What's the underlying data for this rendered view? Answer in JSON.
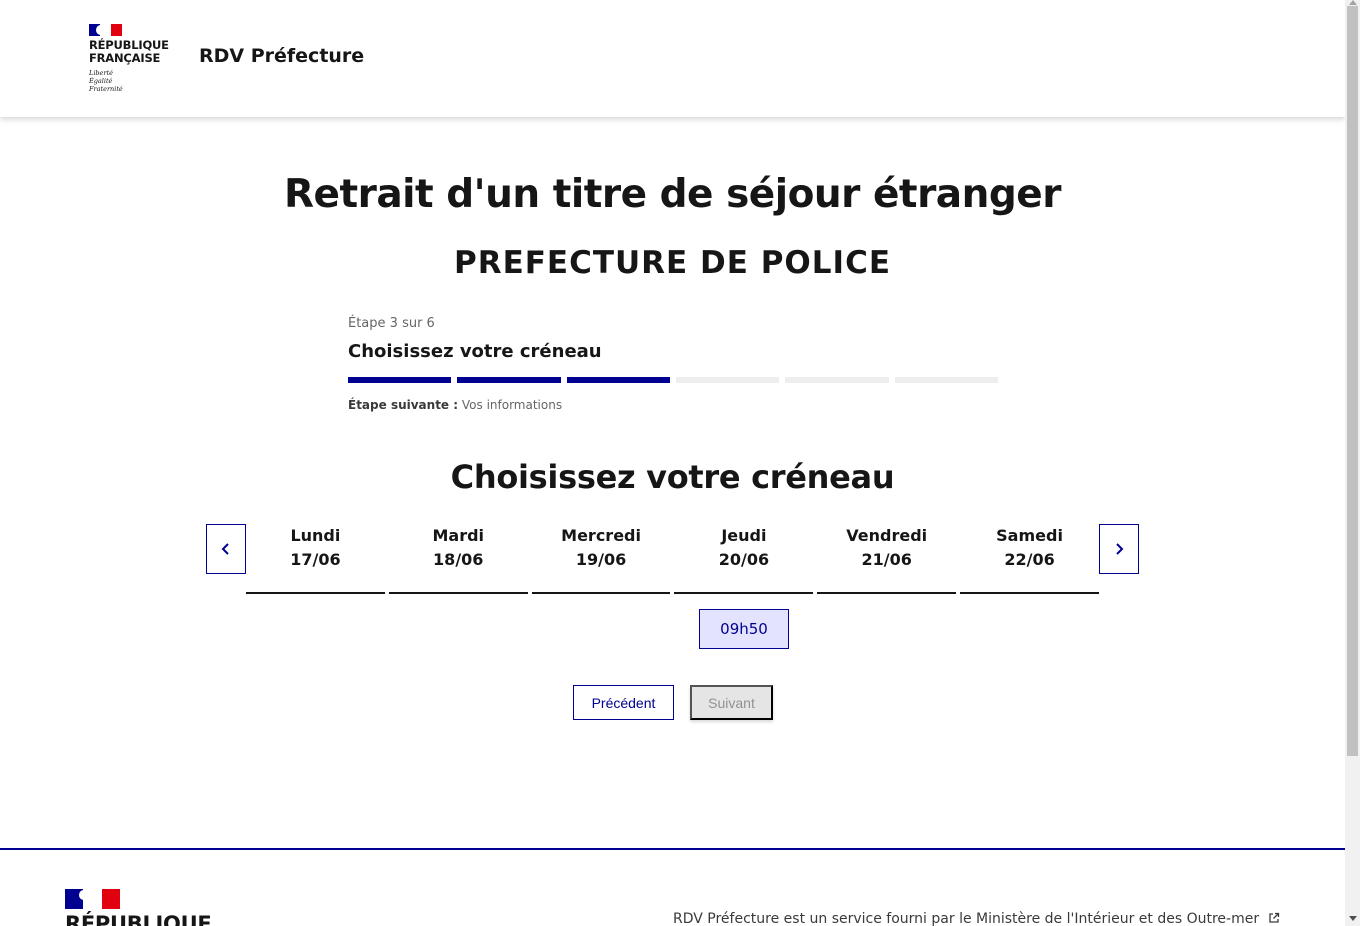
{
  "header": {
    "logo_line1": "RÉPUBLIQUE",
    "logo_line2": "FRANÇAISE",
    "devise_1": "Liberté",
    "devise_2": "Égalité",
    "devise_3": "Fraternité",
    "service_name": "RDV Préfecture"
  },
  "main": {
    "title": "Retrait d'un titre de séjour étranger",
    "subtitle": "PREFECTURE DE POLICE",
    "stepper": {
      "state": "Étape 3 sur 6",
      "title": "Choisissez votre créneau",
      "current_step": 3,
      "total_steps": 6,
      "next_label": "Étape suivante :",
      "next_value": "Vos informations"
    },
    "section_title": "Choisissez votre créneau",
    "days": [
      {
        "name": "Lundi",
        "date": "17/06"
      },
      {
        "name": "Mardi",
        "date": "18/06"
      },
      {
        "name": "Mercredi",
        "date": "19/06"
      },
      {
        "name": "Jeudi",
        "date": "20/06"
      },
      {
        "name": "Vendredi",
        "date": "21/06"
      },
      {
        "name": "Samedi",
        "date": "22/06"
      }
    ],
    "slot": {
      "day": "Jeudi 20/06",
      "time": "09h50"
    },
    "buttons": {
      "previous": "Précédent",
      "next": "Suivant"
    }
  },
  "footer": {
    "logo_line1": "RÉPUBLIQUE",
    "description": "RDV Préfecture est un service fourni par le Ministère de l'Intérieur et des Outre-mer"
  },
  "icons": {
    "prev_week": "chevron-left-icon",
    "next_week": "chevron-right-icon",
    "external_link": "external-link-icon"
  },
  "colors": {
    "primary": "#000091",
    "accent_red": "#e1000f",
    "slot_bg": "#e3e3fd",
    "step_inactive": "#eeeeee",
    "disabled_bg": "#e5e5e5"
  }
}
